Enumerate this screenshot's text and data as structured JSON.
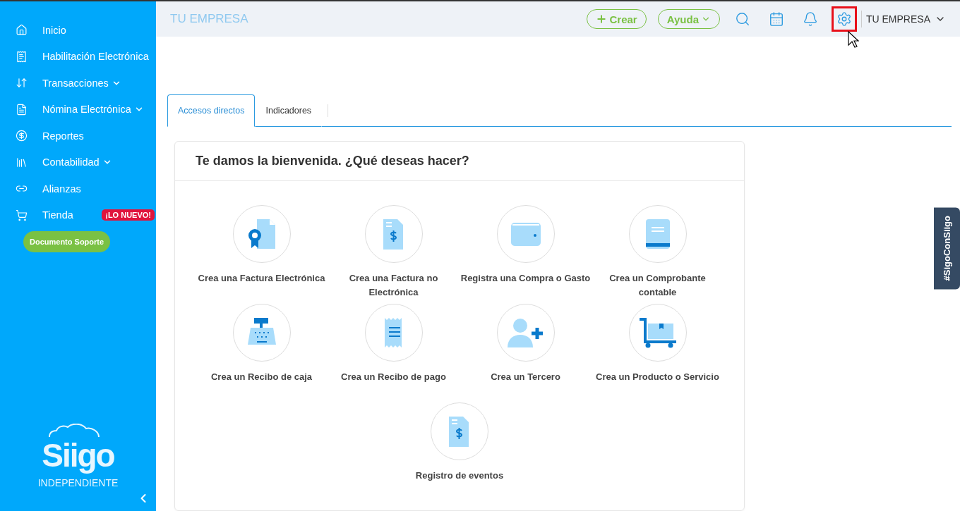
{
  "sidebar": {
    "items": [
      {
        "label": "Inicio",
        "has_submenu": false
      },
      {
        "label": "Habilitación Electrónica",
        "has_submenu": false
      },
      {
        "label": "Transacciones",
        "has_submenu": true
      },
      {
        "label": "Nómina Electrónica",
        "has_submenu": true
      },
      {
        "label": "Reportes",
        "has_submenu": false
      },
      {
        "label": "Contabilidad",
        "has_submenu": true
      },
      {
        "label": "Alianzas",
        "has_submenu": false
      },
      {
        "label": "Tienda",
        "has_submenu": false,
        "badge": "¡LO NUEVO!"
      }
    ],
    "pill_button": "Documento Soporte",
    "logo": {
      "wordmark": "Siigo",
      "subtitle": "INDEPENDIENTE"
    }
  },
  "header": {
    "company": "TU EMPRESA",
    "create_button": "Crear",
    "help_button": "Ayuda",
    "settings_highlighted": true,
    "account": "TU EMPRESA"
  },
  "tabs": [
    {
      "label": "Accesos directos",
      "selected": true
    },
    {
      "label": "Indicadores",
      "selected": false
    }
  ],
  "welcome": {
    "title": "Te damos la bienvenida. ¿Qué deseas hacer?",
    "shortcuts": [
      {
        "label": "Crea una Factura Electrónica"
      },
      {
        "label": "Crea una Factura no Electrónica"
      },
      {
        "label": "Registra una Compra o Gasto"
      },
      {
        "label": "Crea un Comprobante contable"
      },
      {
        "label": "Crea un Recibo de caja"
      },
      {
        "label": "Crea un Recibo de pago"
      },
      {
        "label": "Crea un Tercero"
      },
      {
        "label": "Crea un Producto o Servicio"
      },
      {
        "label": "Registro de eventos"
      }
    ]
  },
  "side_tab": "#SigoConSiigo"
}
